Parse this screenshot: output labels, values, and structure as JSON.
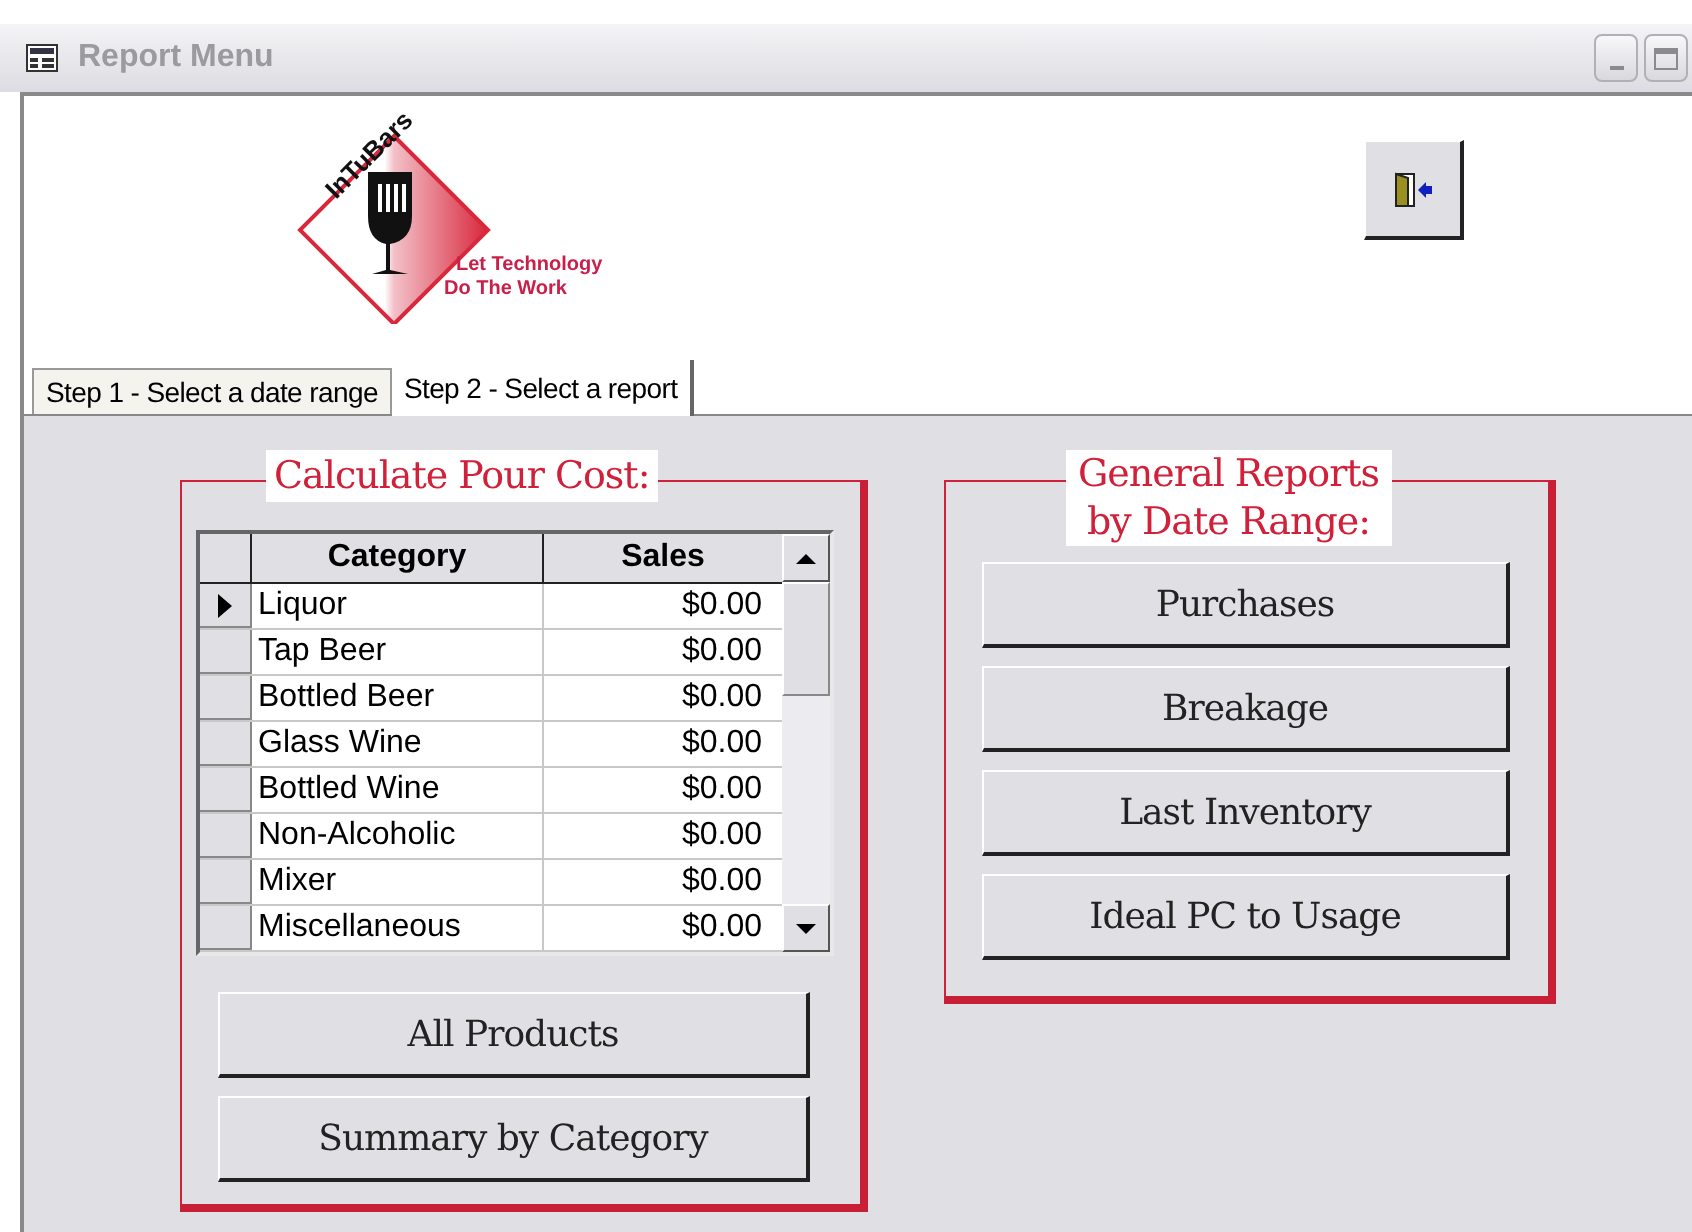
{
  "window": {
    "title": "Report Menu"
  },
  "logo": {
    "brand": "InTuBars",
    "tagline_1": "Let Technology",
    "tagline_2": "Do The Work"
  },
  "tabs": [
    {
      "label": "Step 1 - Select a date range",
      "selected": false
    },
    {
      "label": "Step 2 - Select a report",
      "selected": true
    }
  ],
  "pour_cost": {
    "title": "Calculate Pour Cost:",
    "table": {
      "columns": [
        "Category",
        "Sales"
      ],
      "rows": [
        {
          "category": "Liquor",
          "sales": "$0.00",
          "selected": true
        },
        {
          "category": "Tap Beer",
          "sales": "$0.00",
          "selected": false
        },
        {
          "category": "Bottled Beer",
          "sales": "$0.00",
          "selected": false
        },
        {
          "category": "Glass Wine",
          "sales": "$0.00",
          "selected": false
        },
        {
          "category": "Bottled Wine",
          "sales": "$0.00",
          "selected": false
        },
        {
          "category": "Non-Alcoholic",
          "sales": "$0.00",
          "selected": false
        },
        {
          "category": "Mixer",
          "sales": "$0.00",
          "selected": false
        },
        {
          "category": "Miscellaneous",
          "sales": "$0.00",
          "selected": false
        }
      ]
    },
    "buttons": [
      "All Products",
      "Summary by Category"
    ]
  },
  "general_reports": {
    "title_1": "General Reports",
    "title_2": "by Date Range:",
    "buttons": [
      "Purchases",
      "Breakage",
      "Last Inventory",
      "Ideal PC to Usage"
    ]
  }
}
